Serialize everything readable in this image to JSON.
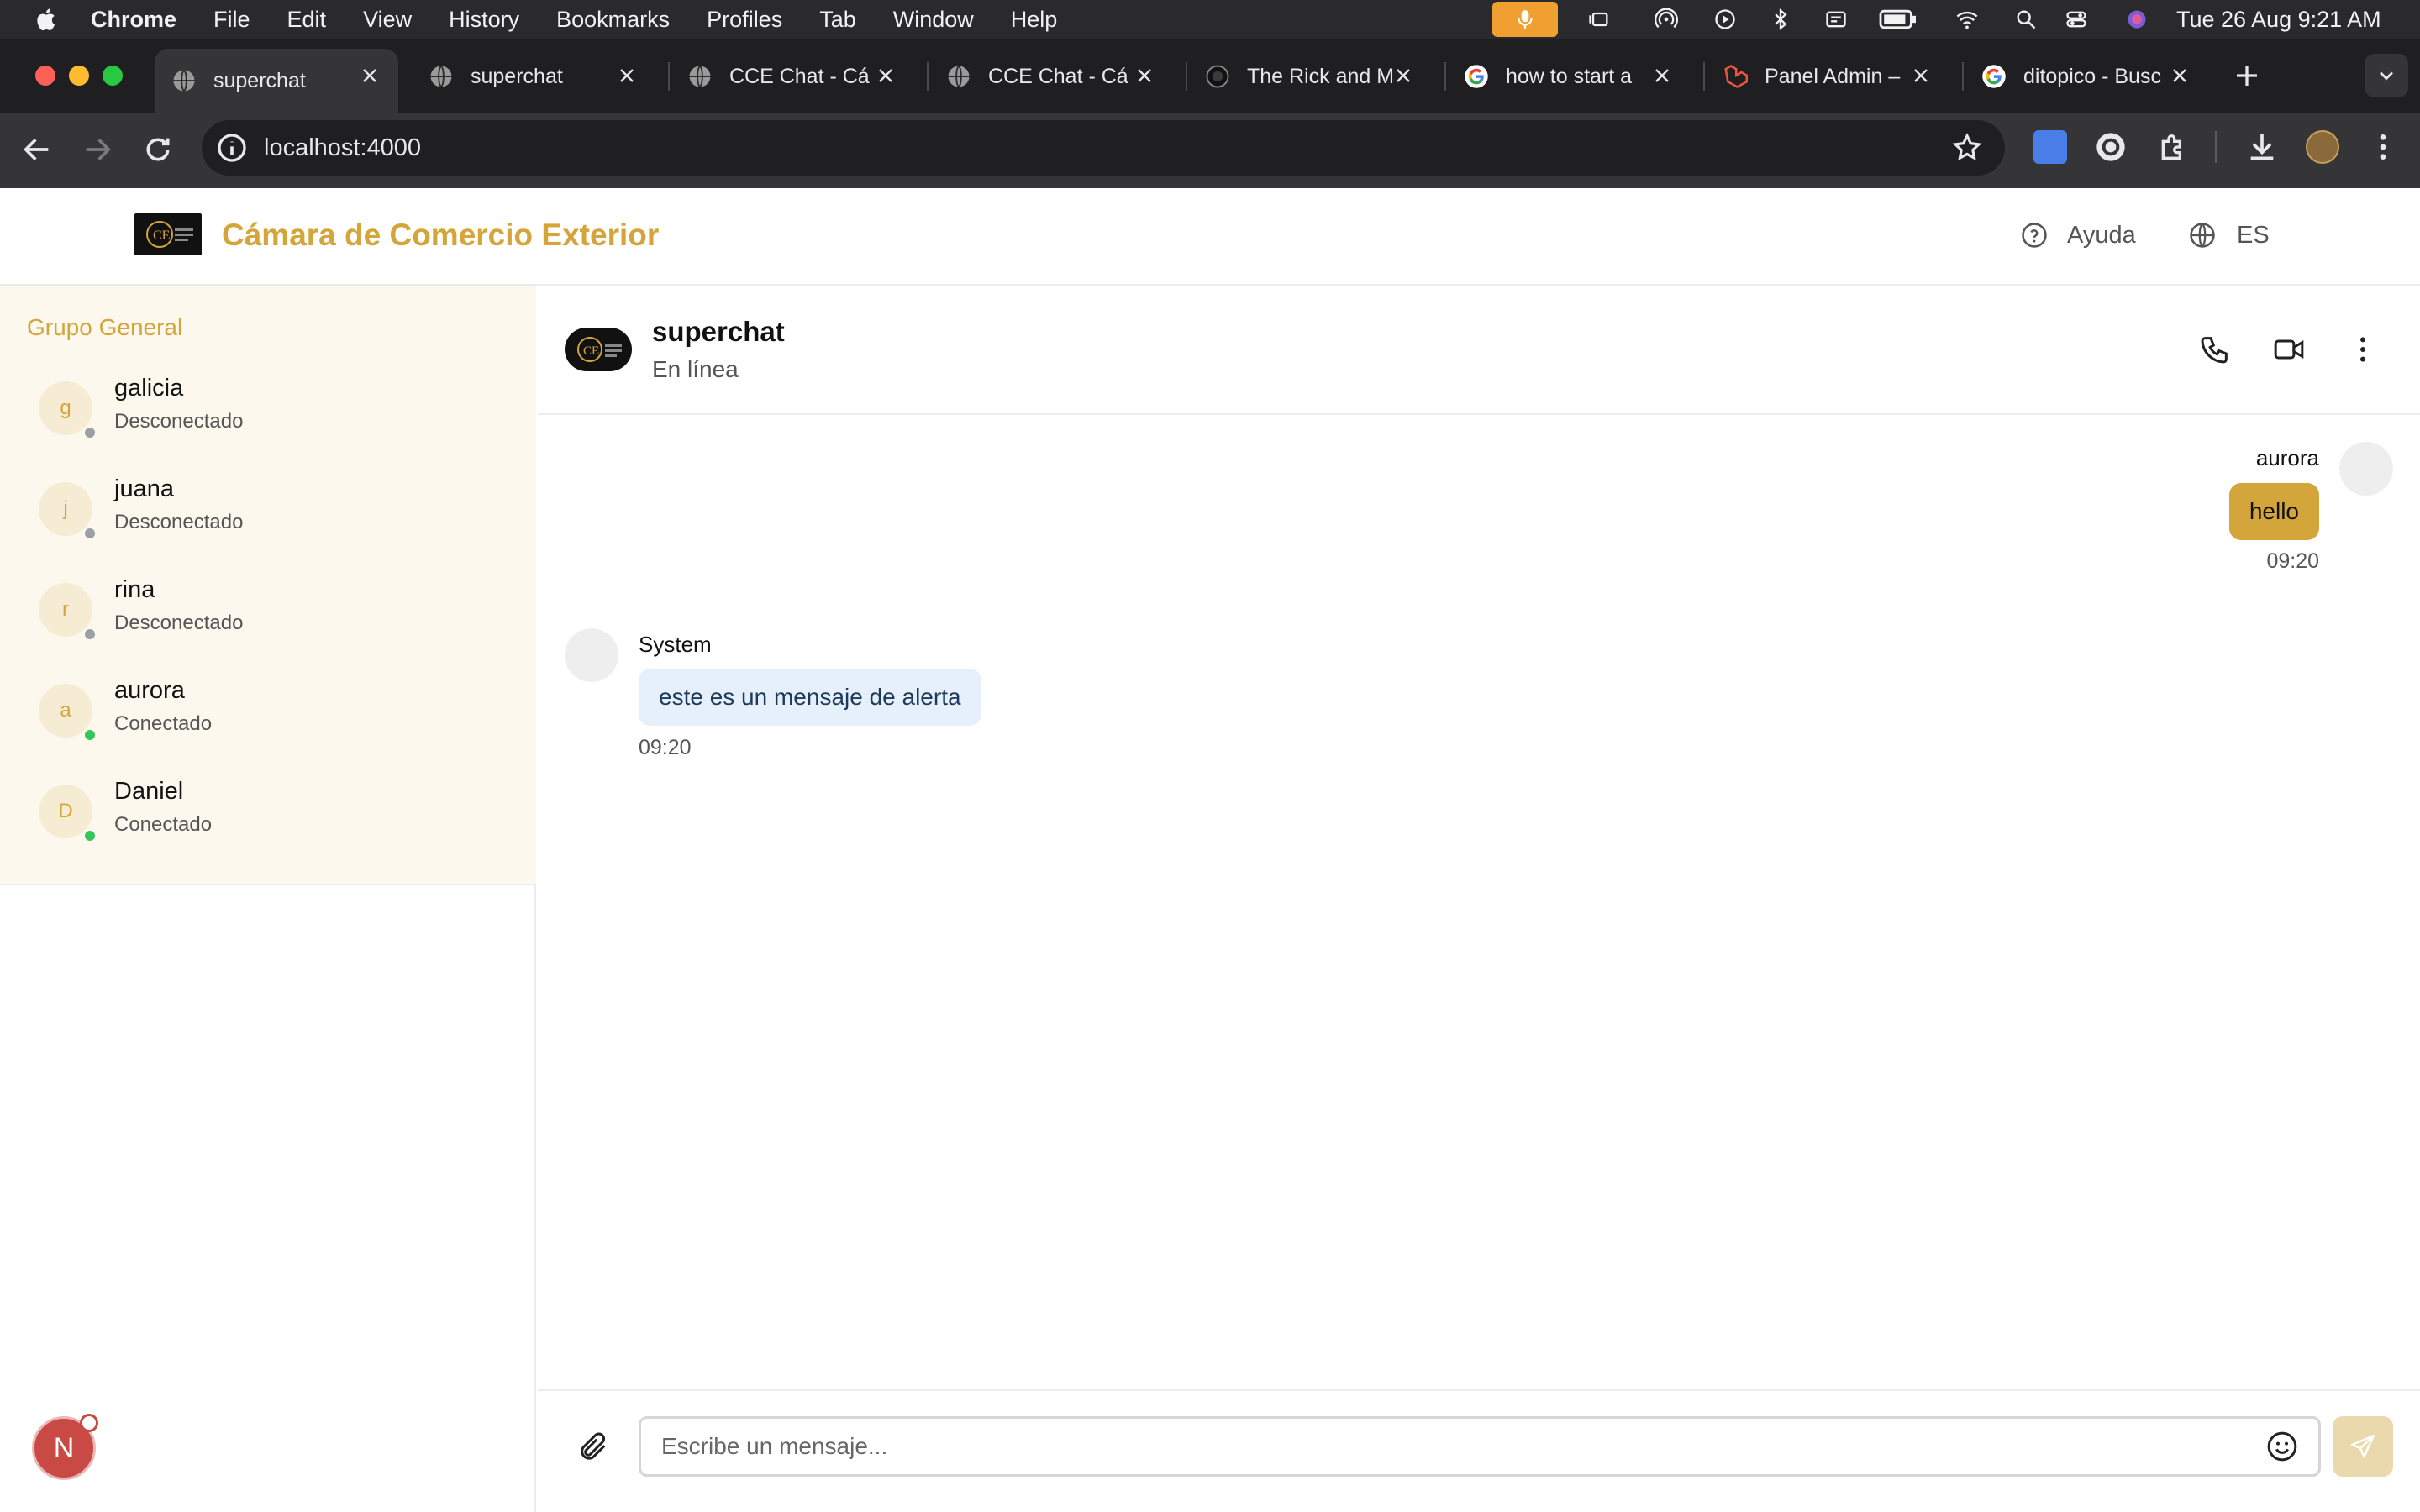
{
  "os_menubar": {
    "app_name": "Chrome",
    "menus": [
      "File",
      "Edit",
      "View",
      "History",
      "Bookmarks",
      "Profiles",
      "Tab",
      "Window",
      "Help"
    ],
    "clock": "Tue 26 Aug  9:21 AM",
    "status_icons": [
      "microphone-icon",
      "stage-manager-icon",
      "airdrop-icon",
      "play-icon",
      "bluetooth-icon",
      "display-icon",
      "battery-icon",
      "wifi-icon",
      "spotlight-icon",
      "control-center-icon",
      "siri-icon"
    ]
  },
  "browser": {
    "tabs": [
      {
        "title": "superchat",
        "active": true,
        "favicon": "globe-icon"
      },
      {
        "title": "superchat",
        "active": false,
        "favicon": "globe-icon"
      },
      {
        "title": "CCE Chat - Cá",
        "active": false,
        "favicon": "globe-icon"
      },
      {
        "title": "CCE Chat - Cá",
        "active": false,
        "favicon": "globe-icon"
      },
      {
        "title": "The Rick and M",
        "active": false,
        "favicon": "rick-morty-icon"
      },
      {
        "title": "how to start a",
        "active": false,
        "favicon": "google-icon"
      },
      {
        "title": "Panel Admin –",
        "active": false,
        "favicon": "laravel-icon"
      },
      {
        "title": "ditopico - Busc",
        "active": false,
        "favicon": "google-icon"
      }
    ],
    "url": "localhost:4000"
  },
  "app": {
    "brand": "Cámara de Comercio Exterior",
    "help_label": "Ayuda",
    "language": "ES",
    "colors": {
      "accent": "#d4a53a",
      "online": "#34c759",
      "offline": "#9aa0a6",
      "system_bubble": "#e6f0fb",
      "user_bubble": "#d4a53a"
    }
  },
  "sidebar": {
    "group_name": "Grupo General",
    "members": [
      {
        "initial": "g",
        "name": "galicia",
        "status": "Desconectado",
        "online": false
      },
      {
        "initial": "j",
        "name": "juana",
        "status": "Desconectado",
        "online": false
      },
      {
        "initial": "r",
        "name": "rina",
        "status": "Desconectado",
        "online": false
      },
      {
        "initial": "a",
        "name": "aurora",
        "status": "Conectado",
        "online": true
      },
      {
        "initial": "D",
        "name": "Daniel",
        "status": "Conectado",
        "online": true
      }
    ],
    "current_user_initial": "N"
  },
  "chat": {
    "name": "superchat",
    "status": "En línea",
    "messages": [
      {
        "sender": "aurora",
        "text": "hello",
        "time": "09:20",
        "own": true
      },
      {
        "sender": "System",
        "text": "este es un mensaje de alerta",
        "time": "09:20",
        "own": false
      }
    ],
    "input_placeholder": "Escribe un mensaje..."
  }
}
